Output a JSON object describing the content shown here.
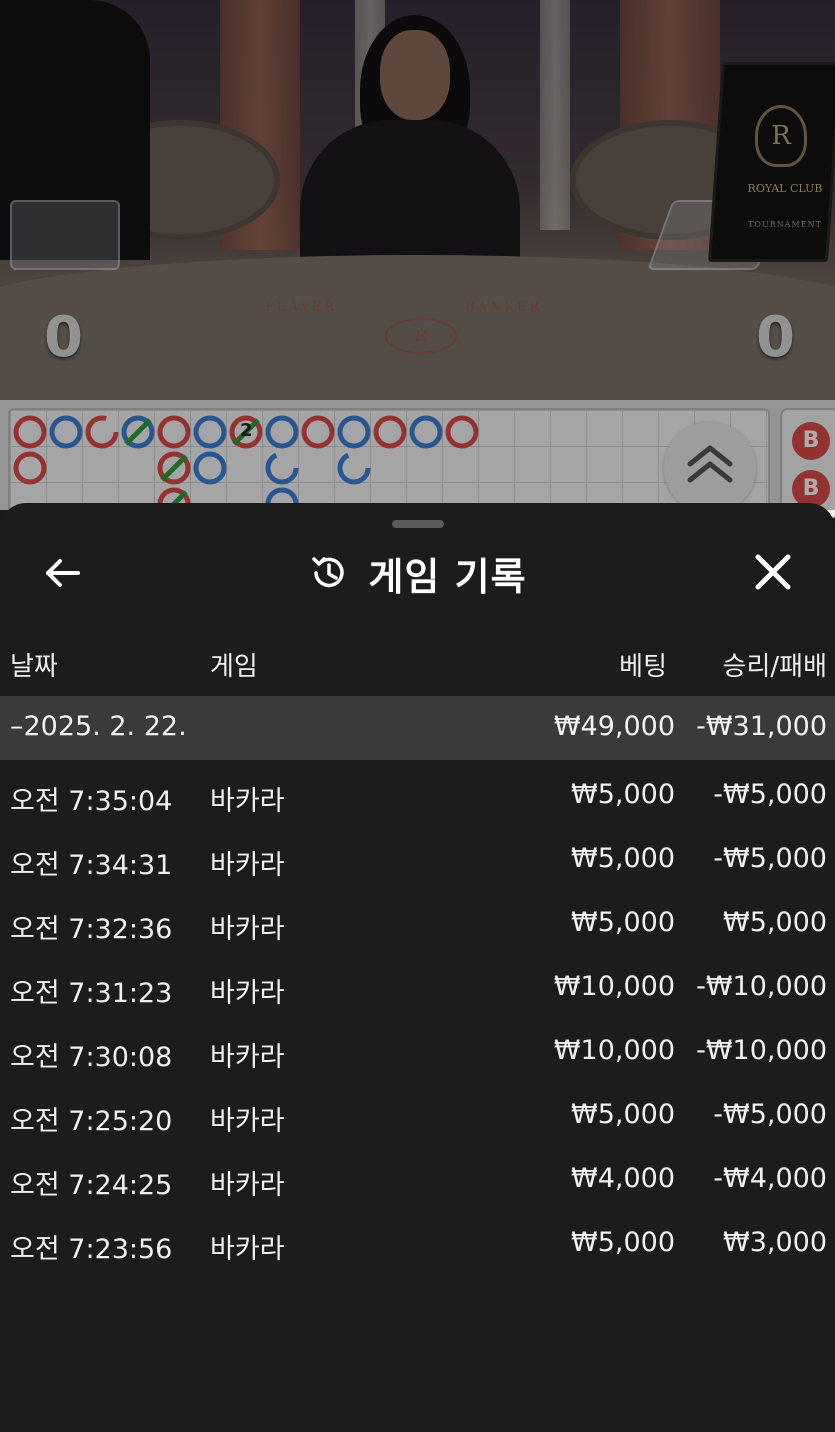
{
  "video": {
    "sign_brand": "ROYAL CLUB",
    "sign_sub": "TOURNAMENT",
    "logo_letter": "R",
    "felt_player": "PLAYER",
    "felt_banker": "BANKER",
    "player_score": "0",
    "banker_score": "0"
  },
  "roadmap": {
    "colors": {
      "banker": "#d94a48",
      "player": "#3a7fd6",
      "tie": "#2e9a3e"
    },
    "side_badges": [
      "B",
      "B"
    ],
    "tie_count_label": "2"
  },
  "history": {
    "title": "게임 기록",
    "columns": {
      "date": "날짜",
      "game": "게임",
      "bet": "베팅",
      "result": "승리/패배"
    },
    "group": {
      "date": "–2025. 2. 22.",
      "bet_total": "₩49,000",
      "result_total": "-₩31,000"
    },
    "rows": [
      {
        "time": "오전 7:35:04",
        "game": "바카라",
        "bet": "₩5,000",
        "result": "-₩5,000"
      },
      {
        "time": "오전 7:34:31",
        "game": "바카라",
        "bet": "₩5,000",
        "result": "-₩5,000"
      },
      {
        "time": "오전 7:32:36",
        "game": "바카라",
        "bet": "₩5,000",
        "result": "₩5,000"
      },
      {
        "time": "오전 7:31:23",
        "game": "바카라",
        "bet": "₩10,000",
        "result": "-₩10,000"
      },
      {
        "time": "오전 7:30:08",
        "game": "바카라",
        "bet": "₩10,000",
        "result": "-₩10,000"
      },
      {
        "time": "오전 7:25:20",
        "game": "바카라",
        "bet": "₩5,000",
        "result": "-₩5,000"
      },
      {
        "time": "오전 7:24:25",
        "game": "바카라",
        "bet": "₩4,000",
        "result": "-₩4,000"
      },
      {
        "time": "오전 7:23:56",
        "game": "바카라",
        "bet": "₩5,000",
        "result": "₩3,000"
      }
    ]
  }
}
